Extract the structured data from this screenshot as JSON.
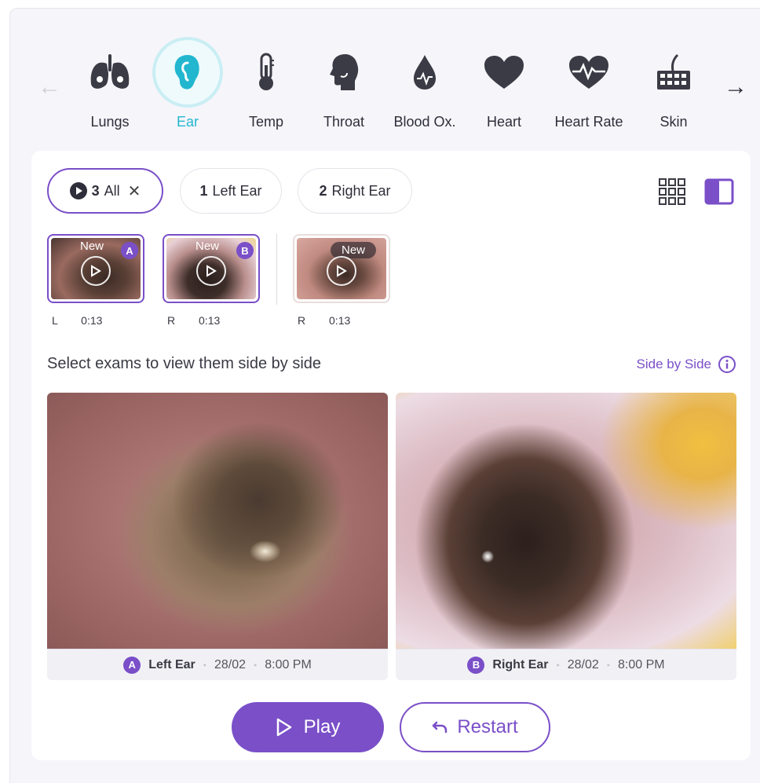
{
  "nav": {
    "prev_arrow": "←",
    "next_arrow": "→",
    "active": "Ear",
    "accent": "#22b7cf",
    "categories": [
      {
        "label": "Lungs",
        "icon": "lungs-icon"
      },
      {
        "label": "Ear",
        "icon": "ear-icon"
      },
      {
        "label": "Temp",
        "icon": "thermometer-icon"
      },
      {
        "label": "Throat",
        "icon": "throat-icon"
      },
      {
        "label": "Blood Ox.",
        "icon": "blood-drop-icon"
      },
      {
        "label": "Heart",
        "icon": "heart-icon"
      },
      {
        "label": "Heart Rate",
        "icon": "heart-rate-icon"
      },
      {
        "label": "Skin",
        "icon": "skin-icon"
      }
    ]
  },
  "filters": [
    {
      "count": "3",
      "label": "All",
      "selected": true,
      "close": "✕"
    },
    {
      "count": "1",
      "label": "Left Ear",
      "selected": false
    },
    {
      "count": "2",
      "label": "Right Ear",
      "selected": false
    }
  ],
  "view_modes": {
    "grid_icon": "grid-view-icon",
    "split_icon": "side-by-side-view-icon",
    "active": "side-by-side"
  },
  "thumbnails": [
    {
      "new_label": "New",
      "badge": "A",
      "side": "L",
      "duration": "0:13",
      "selected": true
    },
    {
      "new_label": "New",
      "badge": "B",
      "side": "R",
      "duration": "0:13",
      "selected": true
    },
    {
      "new_label": "New",
      "badge": "",
      "side": "R",
      "duration": "0:13",
      "selected": false
    }
  ],
  "helper_text": "Select exams to view them side by side",
  "side_by_side_link": "Side by Side",
  "panels": [
    {
      "badge": "A",
      "name": "Left Ear",
      "date": "28/02",
      "time": "8:00 PM",
      "sep": "•"
    },
    {
      "badge": "B",
      "name": "Right Ear",
      "date": "28/02",
      "time": "8:00 PM",
      "sep": "•"
    }
  ],
  "actions": {
    "play": "Play",
    "restart": "Restart"
  },
  "colors": {
    "primary": "#7a4fc8",
    "accent": "#22b7cf",
    "background": "#f6f5fa"
  }
}
